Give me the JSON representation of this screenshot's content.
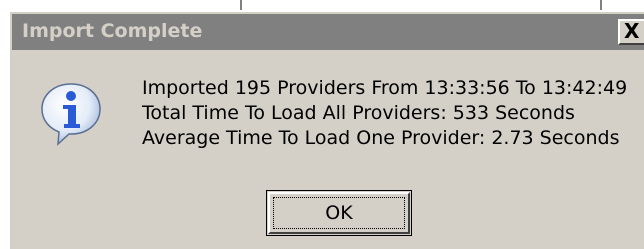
{
  "dialog": {
    "title": "Import Complete",
    "close_glyph": "X",
    "icon": "info-icon",
    "message_lines": [
      "Imported 195 Providers From 13:33:56 To 13:42:49",
      "Total Time To Load All Providers: 533 Seconds",
      "Average Time To Load One Provider: 2.73 Seconds"
    ],
    "ok_label": "OK"
  },
  "colors": {
    "titlebar_inactive": "#808080",
    "title_text": "#d4d0c8",
    "face": "#d4d0c8",
    "icon_blue": "#2a5bd7"
  }
}
